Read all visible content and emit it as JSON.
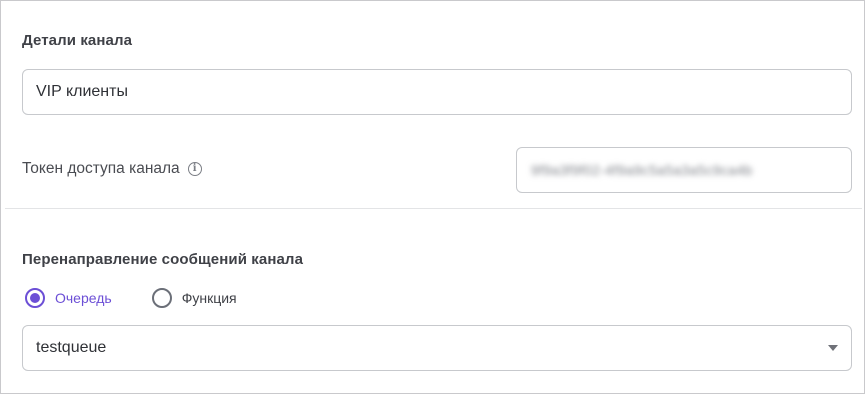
{
  "details": {
    "title": "Детали канала",
    "channel_name_value": "VIP клиенты"
  },
  "token": {
    "label": "Токен доступа канала",
    "info_icon": "info-icon",
    "value": "9f9a3f9f02-4f9a9c5a5a3a5c9ca4b"
  },
  "redirect": {
    "title": "Перенаправление сообщений канала",
    "options": [
      {
        "label": "Очередь",
        "checked": true
      },
      {
        "label": "Функция",
        "checked": false
      }
    ],
    "selected_queue": "testqueue",
    "dropdown_icon": "chevron-down-icon"
  },
  "colors": {
    "accent": "#6c4fd6",
    "border": "#c7c9cd",
    "text": "#3f4147"
  }
}
